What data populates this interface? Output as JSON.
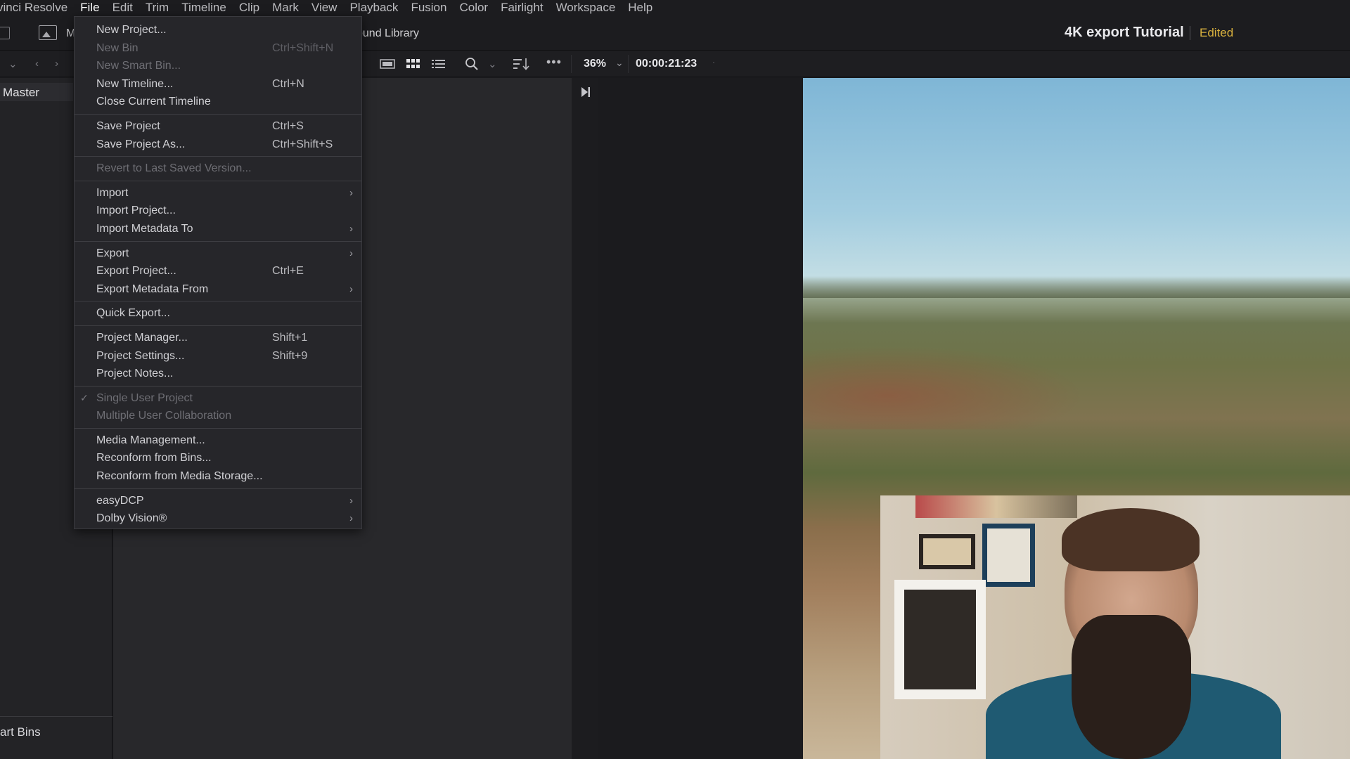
{
  "menubar": {
    "app_name": "vinci Resolve",
    "items": [
      "File",
      "Edit",
      "Trim",
      "Timeline",
      "Clip",
      "Mark",
      "View",
      "Playback",
      "Fusion",
      "Color",
      "Fairlight",
      "Workspace",
      "Help"
    ],
    "active_item": "File"
  },
  "toolbar": {
    "media_label": "M",
    "sound_library_label": "ound Library",
    "project_title": "4K export Tutorial",
    "project_status": "Edited",
    "status_color": "#d8b13e"
  },
  "viewer": {
    "zoom": "36%",
    "timecode": "00:00:21:23"
  },
  "bins": {
    "master_label": "Master",
    "smart_bins_label": "art Bins"
  },
  "file_menu": {
    "groups": [
      [
        {
          "label": "New Project...",
          "shortcut": "",
          "disabled": false,
          "submenu": false
        },
        {
          "label": "New Bin",
          "shortcut": "Ctrl+Shift+N",
          "disabled": true,
          "submenu": false
        },
        {
          "label": "New Smart Bin...",
          "shortcut": "",
          "disabled": true,
          "submenu": false
        },
        {
          "label": "New Timeline...",
          "shortcut": "Ctrl+N",
          "disabled": false,
          "submenu": false
        },
        {
          "label": "Close Current Timeline",
          "shortcut": "",
          "disabled": false,
          "submenu": false
        }
      ],
      [
        {
          "label": "Save Project",
          "shortcut": "Ctrl+S",
          "disabled": false,
          "submenu": false
        },
        {
          "label": "Save Project As...",
          "shortcut": "Ctrl+Shift+S",
          "disabled": false,
          "submenu": false
        }
      ],
      [
        {
          "label": "Revert to Last Saved Version...",
          "shortcut": "",
          "disabled": true,
          "submenu": false
        }
      ],
      [
        {
          "label": "Import",
          "shortcut": "",
          "disabled": false,
          "submenu": true
        },
        {
          "label": "Import Project...",
          "shortcut": "",
          "disabled": false,
          "submenu": false
        },
        {
          "label": "Import Metadata To",
          "shortcut": "",
          "disabled": false,
          "submenu": true
        }
      ],
      [
        {
          "label": "Export",
          "shortcut": "",
          "disabled": false,
          "submenu": true
        },
        {
          "label": "Export Project...",
          "shortcut": "Ctrl+E",
          "disabled": false,
          "submenu": false
        },
        {
          "label": "Export Metadata From",
          "shortcut": "",
          "disabled": false,
          "submenu": true
        }
      ],
      [
        {
          "label": "Quick Export...",
          "shortcut": "",
          "disabled": false,
          "submenu": false
        }
      ],
      [
        {
          "label": "Project Manager...",
          "shortcut": "Shift+1",
          "disabled": false,
          "submenu": false
        },
        {
          "label": "Project Settings...",
          "shortcut": "Shift+9",
          "disabled": false,
          "submenu": false
        },
        {
          "label": "Project Notes...",
          "shortcut": "",
          "disabled": false,
          "submenu": false
        }
      ],
      [
        {
          "label": "Single User Project",
          "shortcut": "",
          "disabled": true,
          "submenu": false,
          "checked": true
        },
        {
          "label": "Multiple User Collaboration",
          "shortcut": "",
          "disabled": true,
          "submenu": false
        }
      ],
      [
        {
          "label": "Media Management...",
          "shortcut": "",
          "disabled": false,
          "submenu": false
        },
        {
          "label": "Reconform from Bins...",
          "shortcut": "",
          "disabled": false,
          "submenu": false
        },
        {
          "label": "Reconform from Media Storage...",
          "shortcut": "",
          "disabled": false,
          "submenu": false
        }
      ],
      [
        {
          "label": "easyDCP",
          "shortcut": "",
          "disabled": false,
          "submenu": true
        },
        {
          "label": "Dolby Vision®",
          "shortcut": "",
          "disabled": false,
          "submenu": true
        }
      ]
    ]
  }
}
